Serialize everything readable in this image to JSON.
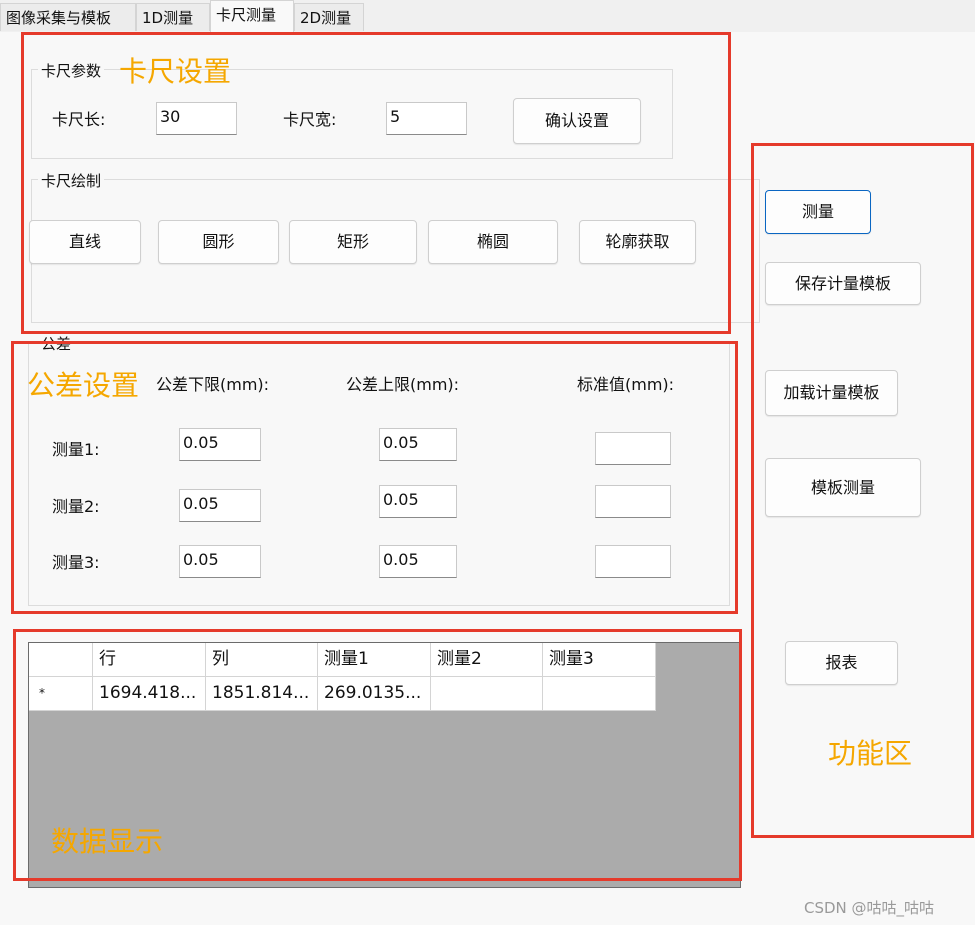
{
  "tabs": [
    "图像采集与模板",
    "1D测量",
    "卡尺测量",
    "2D测量"
  ],
  "caliper_params": {
    "legend": "卡尺参数",
    "length_label": "卡尺长:",
    "length_value": "30",
    "width_label": "卡尺宽:",
    "width_value": "5",
    "confirm_button": "确认设置"
  },
  "caliper_draw": {
    "legend": "卡尺绘制",
    "buttons": [
      "直线",
      "圆形",
      "矩形",
      "椭圆",
      "轮廓获取"
    ]
  },
  "tolerance": {
    "legend": "公差",
    "lower_header": "公差下限(mm):",
    "upper_header": "公差上限(mm):",
    "standard_header": "标准值(mm):",
    "rows": [
      {
        "label": "测量1:",
        "lower": "0.05",
        "upper": "0.05",
        "standard": ""
      },
      {
        "label": "测量2:",
        "lower": "0.05",
        "upper": "0.05",
        "standard": ""
      },
      {
        "label": "测量3:",
        "lower": "0.05",
        "upper": "0.05",
        "standard": ""
      }
    ]
  },
  "data_grid": {
    "columns": [
      "",
      "行",
      "列",
      "测量1",
      "测量2",
      "测量3"
    ],
    "rows": [
      [
        "*",
        "1694.418...",
        "1851.814...",
        "269.0135...",
        "",
        ""
      ]
    ]
  },
  "function_buttons": {
    "measure": "测量",
    "save_template": "保存计量模板",
    "load_template": "加载计量模板",
    "template_measure": "模板测量",
    "report": "报表"
  },
  "annotations": {
    "caliper_settings": "卡尺设置",
    "tolerance_settings": "公差设置",
    "data_display": "数据显示",
    "function_area": "功能区"
  },
  "watermark": "CSDN @咕咕_咕咕",
  "colors": {
    "annotation_red": "#e53a2b",
    "annotation_text": "#f5a700",
    "focus_blue": "#0a66c2",
    "grid_background": "#ababab"
  }
}
